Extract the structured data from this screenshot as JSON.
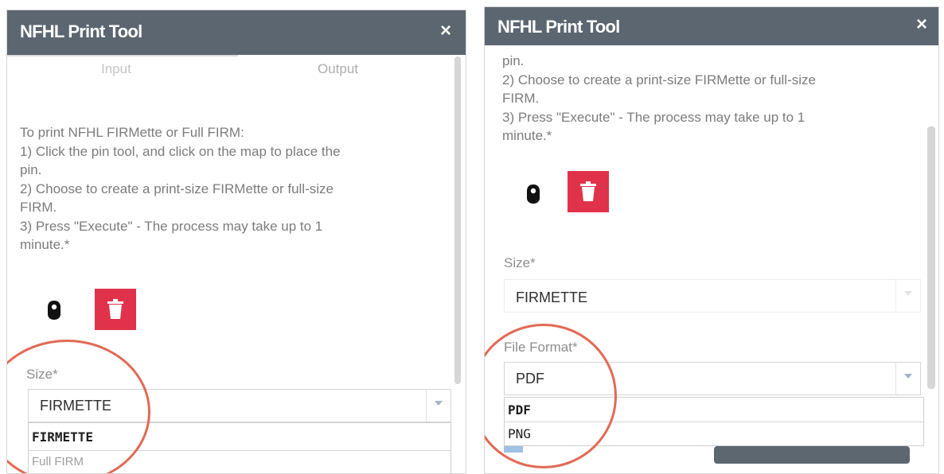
{
  "left_panel": {
    "title": "NFHL Print Tool",
    "close_glyph": "×",
    "tabs": [
      {
        "label": "Input",
        "active": false
      },
      {
        "label": "Output",
        "active": false
      }
    ],
    "instructions": [
      "To print NFHL FIRMette or Full FIRM:",
      "1) Click the pin tool, and click on the map to place the",
      "pin.",
      "2) Choose to create a print-size FIRMette or full-size",
      "FIRM.",
      "3) Press \"Execute\" - The process may take up to 1",
      "minute.*"
    ],
    "size": {
      "label": "Size*",
      "value": "FIRMETTE",
      "options": [
        "FIRMETTE",
        "Full FIRM"
      ]
    }
  },
  "right_panel": {
    "title": "NFHL Print Tool",
    "close_glyph": "×",
    "instructions": [
      "pin.",
      "2) Choose to create a print-size FIRMette or full-size",
      "FIRM.",
      "3) Press \"Execute\" - The process may take up to 1",
      "minute.*"
    ],
    "size": {
      "label": "Size*",
      "value": "FIRMETTE"
    },
    "file_format": {
      "label": "File Format*",
      "value": "PDF",
      "options": [
        "PDF",
        "PNG"
      ]
    }
  },
  "icons": {
    "pin": "pin-icon",
    "trash": "trash-icon",
    "close": "close-icon",
    "dropdown_arrow": "chevron-down-icon"
  },
  "colors": {
    "titlebar": "#5b6670",
    "trash_button": "#e0334b",
    "annotation_circle": "#e16a55",
    "instruction_text": "#7c7c7c"
  }
}
